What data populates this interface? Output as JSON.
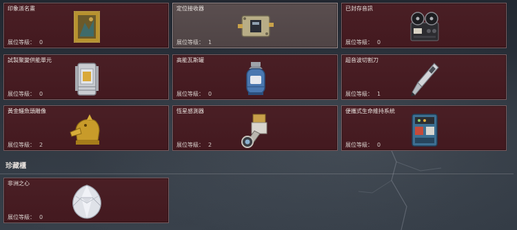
{
  "items": [
    {
      "title": "印象派名畫",
      "level_label": "展位等級：",
      "level": "0",
      "icon": "framed-painting-icon"
    },
    {
      "title": "定位接收器",
      "level_label": "展位等级：",
      "level": "1",
      "icon": "locator-receiver-icon",
      "selected": true
    },
    {
      "title": "已封存音訊",
      "level_label": "展位等級：",
      "level": "0",
      "icon": "reel-tape-recorder-icon"
    },
    {
      "title": "試製聚變供能單元",
      "level_label": "展位等級：",
      "level": "0",
      "icon": "fusion-power-cell-icon"
    },
    {
      "title": "高能瓦斯罐",
      "level_label": "展位等級：",
      "level": "0",
      "icon": "gas-canister-icon"
    },
    {
      "title": "超音波切割刀",
      "level_label": "展位等級：",
      "level": "1",
      "icon": "ultrasonic-cutter-icon"
    },
    {
      "title": "黃金鱷魚頭雕像",
      "level_label": "展位等級：",
      "level": "2",
      "icon": "golden-crocodile-head-icon"
    },
    {
      "title": "恆星感測器",
      "level_label": "展位等級：",
      "level": "2",
      "icon": "star-sensor-icon"
    },
    {
      "title": "便攜式生命維持系統",
      "level_label": "展位等級：",
      "level": "0",
      "icon": "life-support-system-icon"
    }
  ],
  "collection": {
    "header": "珍藏櫃",
    "items": [
      {
        "title": "非洲之心",
        "level_label": "展位等級：",
        "level": "0",
        "icon": "heart-of-africa-diamond-icon"
      }
    ]
  },
  "colors": {
    "card_bg": "#4a1f25",
    "card_selected_bg": "#5a4e4f",
    "card_border": "#7a5a5e",
    "background": "#2b323b"
  }
}
